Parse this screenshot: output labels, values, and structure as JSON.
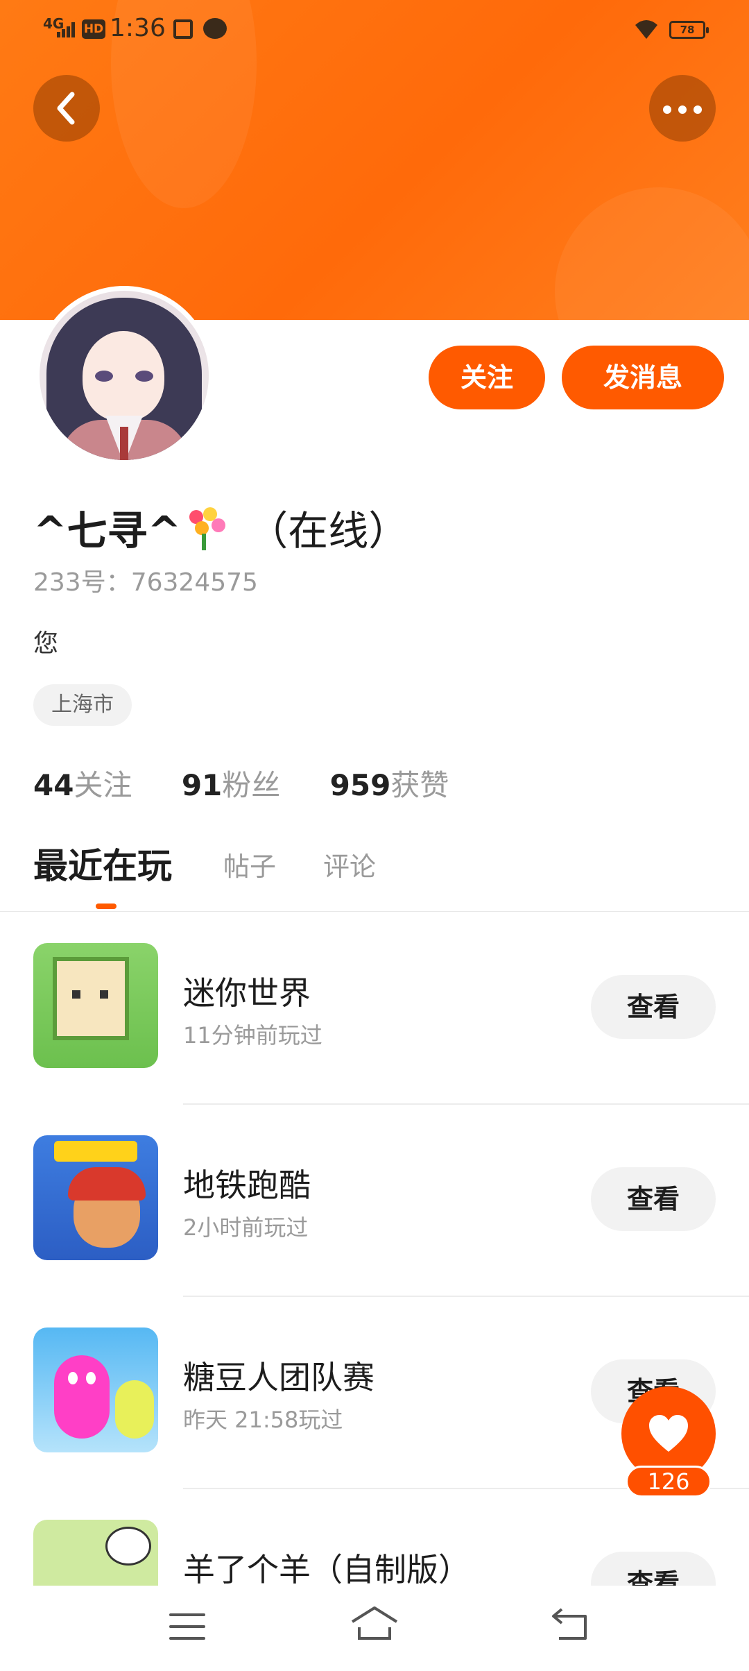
{
  "status_bar": {
    "network": "4G",
    "hd": "HD",
    "time": "1:36",
    "battery": "78"
  },
  "header": {
    "back_icon": "chevron-left-icon",
    "more_icon": "more-dots-icon",
    "banner_color": "#ff7a14"
  },
  "profile": {
    "avatar_icon": "anime-girl-avatar",
    "nickname": "^七寻^",
    "nickname_emoji": "flower-bouquet-icon",
    "online_status": "（在线）",
    "uid": "233号：76324575",
    "bio": "您",
    "location": "上海市"
  },
  "actions": {
    "follow_label": "关注",
    "message_label": "发消息",
    "accent_color": "#ff5a00"
  },
  "stats": [
    {
      "value": "44",
      "label": "关注"
    },
    {
      "value": "91",
      "label": "粉丝"
    },
    {
      "value": "959",
      "label": "获赞"
    }
  ],
  "tabs": [
    {
      "label": "最近在玩",
      "active": true
    },
    {
      "label": "帖子",
      "active": false
    },
    {
      "label": "评论",
      "active": false
    }
  ],
  "games": [
    {
      "name": "迷你世界",
      "time": "11分钟前玩过",
      "view_label": "查看",
      "icon": "mini-world-icon"
    },
    {
      "name": "地铁跑酷",
      "time": "2小时前玩过",
      "view_label": "查看",
      "icon": "subway-surfers-icon"
    },
    {
      "name": "糖豆人团队赛",
      "time": "昨天 21:58玩过",
      "view_label": "查看",
      "icon": "fall-guys-icon"
    },
    {
      "name": "羊了个羊（自制版）",
      "time": "",
      "view_label": "查看",
      "icon": "sheep-game-icon"
    }
  ],
  "like_fab": {
    "icon": "heart-icon",
    "count": "126"
  },
  "nav_bar": {
    "menu_icon": "menu-icon",
    "home_icon": "home-icon",
    "back_icon": "back-icon"
  }
}
